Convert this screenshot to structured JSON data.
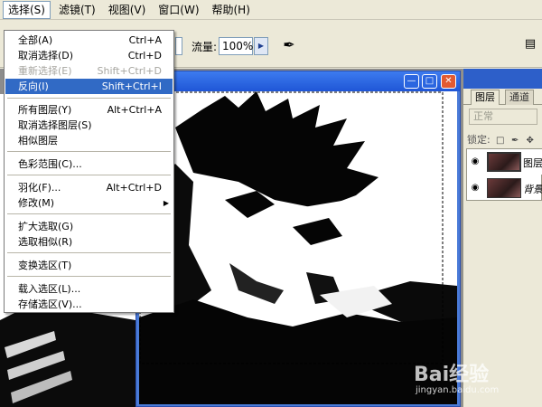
{
  "menubar": {
    "items": [
      {
        "label": "选择(S)",
        "active": true
      },
      {
        "label": "滤镜(T)",
        "active": false
      },
      {
        "label": "视图(V)",
        "active": false
      },
      {
        "label": "窗口(W)",
        "active": false
      },
      {
        "label": "帮助(H)",
        "active": false
      }
    ]
  },
  "options": {
    "flow_label": "流量:",
    "flow_value": "100%"
  },
  "select_menu": {
    "items": [
      {
        "label": "全部(A)",
        "shortcut": "Ctrl+A",
        "state": "normal"
      },
      {
        "label": "取消选择(D)",
        "shortcut": "Ctrl+D",
        "state": "normal"
      },
      {
        "label": "重新选择(E)",
        "shortcut": "Shift+Ctrl+D",
        "state": "disabled"
      },
      {
        "label": "反向(I)",
        "shortcut": "Shift+Ctrl+I",
        "state": "highlight"
      },
      {
        "label": "所有图层(Y)",
        "shortcut": "Alt+Ctrl+A",
        "state": "normal"
      },
      {
        "label": "取消选择图层(S)",
        "shortcut": "",
        "state": "normal"
      },
      {
        "label": "相似图层",
        "shortcut": "",
        "state": "normal"
      },
      {
        "label": "色彩范围(C)...",
        "shortcut": "",
        "state": "normal"
      },
      {
        "label": "羽化(F)...",
        "shortcut": "Alt+Ctrl+D",
        "state": "normal"
      },
      {
        "label": "修改(M)",
        "shortcut": "",
        "state": "submenu"
      },
      {
        "label": "扩大选取(G)",
        "shortcut": "",
        "state": "normal"
      },
      {
        "label": "选取相似(R)",
        "shortcut": "",
        "state": "normal"
      },
      {
        "label": "变换选区(T)",
        "shortcut": "",
        "state": "normal"
      },
      {
        "label": "载入选区(L)...",
        "shortcut": "",
        "state": "normal"
      },
      {
        "label": "存储选区(V)...",
        "shortcut": "",
        "state": "normal"
      }
    ]
  },
  "layers_panel": {
    "tabs": [
      "图层",
      "通道"
    ],
    "blend_mode": "正常",
    "lock_label": "锁定:",
    "layers": [
      {
        "name": "图层",
        "italic": false
      },
      {
        "name": "背景",
        "italic": true
      }
    ]
  },
  "watermark": {
    "brand": "Bai经验",
    "url": "jingyan.baidu.com"
  },
  "colors": {
    "menu_highlight": "#316ac5",
    "title_bar": "#1f56d6",
    "ui_face": "#ece9d8"
  }
}
